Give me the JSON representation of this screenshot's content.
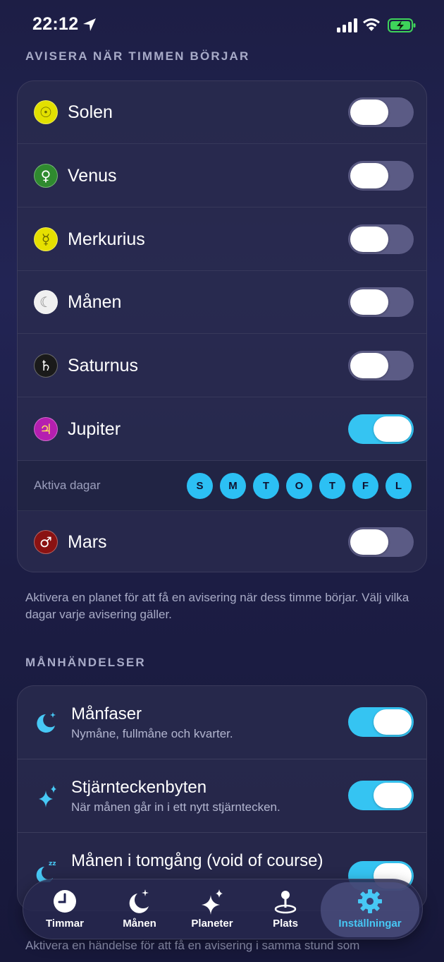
{
  "status_bar": {
    "time": "22:12"
  },
  "notify_section": {
    "header": "AVISERA NÄR TIMMEN BÖRJAR",
    "planets": [
      {
        "name": "Solen",
        "icon": "sun-symbol-icon",
        "glyph": "☉",
        "color": "#e2e000",
        "glyph_color": "#6b6a00",
        "on": false
      },
      {
        "name": "Venus",
        "icon": "venus-symbol-icon",
        "glyph": "♀",
        "color": "#2f8a2f",
        "glyph_color": "#ffffff",
        "on": false
      },
      {
        "name": "Merkurius",
        "icon": "mercury-symbol-icon",
        "glyph": "☿",
        "color": "#e6e000",
        "glyph_color": "#6b6a00",
        "on": false
      },
      {
        "name": "Månen",
        "icon": "moon-symbol-icon",
        "glyph": "☾",
        "color": "#f0f0f0",
        "glyph_color": "#8a8a8a",
        "on": false
      },
      {
        "name": "Saturnus",
        "icon": "saturn-symbol-icon",
        "glyph": "♄",
        "color": "#1a1a1a",
        "glyph_color": "#ffffff",
        "on": false
      },
      {
        "name": "Jupiter",
        "icon": "jupiter-symbol-icon",
        "glyph": "♃",
        "color": "#b51fb0",
        "glyph_color": "#ffe15a",
        "on": true
      },
      {
        "name": "Mars",
        "icon": "mars-symbol-icon",
        "glyph": "♂",
        "color": "#8a1212",
        "glyph_color": "#ffffff",
        "on": false
      }
    ],
    "active_days": {
      "label": "Aktiva dagar",
      "days": [
        "S",
        "M",
        "T",
        "O",
        "T",
        "F",
        "L"
      ]
    },
    "footnote": "Aktivera en planet för att få en avisering när dess timme börjar. Välj vilka dagar varje avisering gäller."
  },
  "moon_section": {
    "header": "MÅNHÄNDELSER",
    "items": [
      {
        "title": "Månfaser",
        "subtitle": "Nymåne, fullmåne och kvarter.",
        "icon": "moon-phase-icon",
        "on": true
      },
      {
        "title": "Stjärnteckenbyten",
        "subtitle": "När månen går in i ett nytt stjärntecken.",
        "icon": "sparkles-icon",
        "on": true
      },
      {
        "title": "Månen i tomgång (void of course)",
        "subtitle": "",
        "icon": "moon-sleep-icon",
        "on": true
      }
    ],
    "footnote_partial": "Aktivera en händelse för att få en avisering i samma stund som"
  },
  "tab_bar": {
    "tabs": [
      {
        "label": "Timmar",
        "icon": "clock-icon",
        "active": false
      },
      {
        "label": "Månen",
        "icon": "moon-stars-icon",
        "active": false
      },
      {
        "label": "Planeter",
        "icon": "sparkles-icon",
        "active": false
      },
      {
        "label": "Plats",
        "icon": "location-pin-icon",
        "active": false
      },
      {
        "label": "Inställningar",
        "icon": "gear-icon",
        "active": true
      }
    ]
  },
  "colors": {
    "accent": "#35c4f2",
    "toggle_off": "#5b5b85",
    "background": "#1f2150"
  }
}
